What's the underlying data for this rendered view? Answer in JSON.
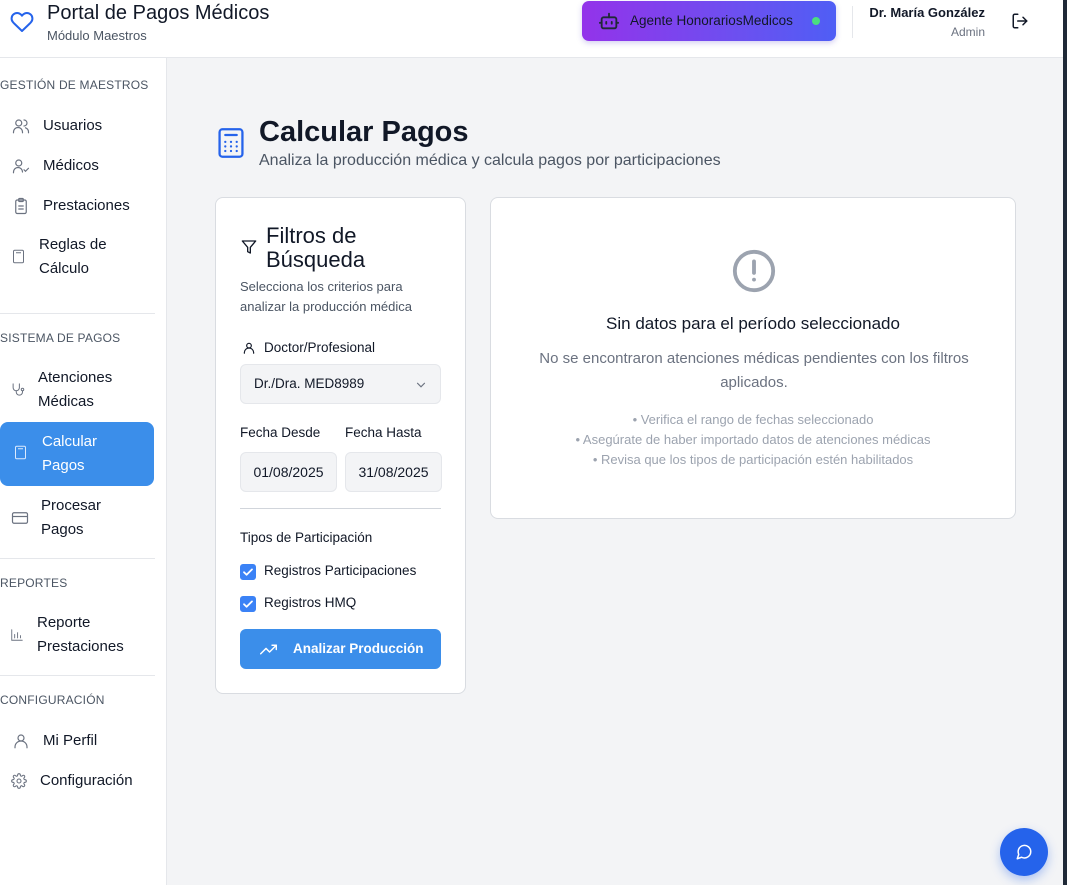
{
  "header": {
    "app_title": "Portal de Pagos Médicos",
    "app_subtitle": "Módulo Maestros",
    "agent_button": "Agente HonorariosMedicos",
    "user_name": "Dr. María González",
    "user_role": "Admin",
    "icons": {
      "brand": "heart-icon",
      "agent": "robot-icon",
      "logout": "logout-icon"
    },
    "status_color": "#4ade80"
  },
  "sidebar": {
    "sections": [
      {
        "title": "GESTIÓN DE MAESTROS",
        "items": [
          {
            "label": "Usuarios",
            "icon": "users-icon"
          },
          {
            "label": "Médicos",
            "icon": "user-check-icon"
          },
          {
            "label": "Prestaciones",
            "icon": "clipboard-icon"
          },
          {
            "label": "Reglas de Cálculo",
            "icon": "calculator-icon"
          }
        ]
      },
      {
        "title": "SISTEMA DE PAGOS",
        "items": [
          {
            "label": "Atenciones Médicas",
            "icon": "stethoscope-icon"
          },
          {
            "label": "Calcular Pagos",
            "icon": "calculator-icon",
            "active": true
          },
          {
            "label": "Procesar Pagos",
            "icon": "credit-card-icon"
          }
        ]
      },
      {
        "title": "REPORTES",
        "items": [
          {
            "label": "Reporte Prestaciones",
            "icon": "bar-chart-icon"
          }
        ]
      },
      {
        "title": "CONFIGURACIÓN",
        "items": [
          {
            "label": "Mi Perfil",
            "icon": "user-icon"
          },
          {
            "label": "Configuración",
            "icon": "gear-icon"
          }
        ]
      }
    ],
    "active_color": "#3b8eea"
  },
  "main": {
    "title": "Calcular Pagos",
    "subtitle": "Analiza la producción médica y calcula pagos por participaciones",
    "filters": {
      "title": "Filtros de Búsqueda",
      "description": "Selecciona los criterios para analizar la producción médica",
      "doctor_label": "Doctor/Profesional",
      "doctor_value": "Dr./Dra. MED8989",
      "date_from_label": "Fecha Desde",
      "date_from_value": "01/08/2025",
      "date_to_label": "Fecha Hasta",
      "date_to_value": "31/08/2025",
      "participation_label": "Tipos de Participación",
      "checkbox_1": "Registros Participaciones",
      "checkbox_2": "Registros HMQ",
      "checkbox_1_checked": true,
      "checkbox_2_checked": true,
      "analyze_button": "Analizar Producción"
    },
    "empty_state": {
      "title": "Sin datos para el período seleccionado",
      "description": "No se encontraron atenciones médicas pendientes con los filtros aplicados.",
      "tips": [
        "• Verifica el rango de fechas seleccionado",
        "• Asegúrate de haber importado datos de atenciones médicas",
        "• Revisa que los tipos de participación estén habilitados"
      ]
    }
  },
  "fab": {
    "icon": "chat-icon"
  }
}
